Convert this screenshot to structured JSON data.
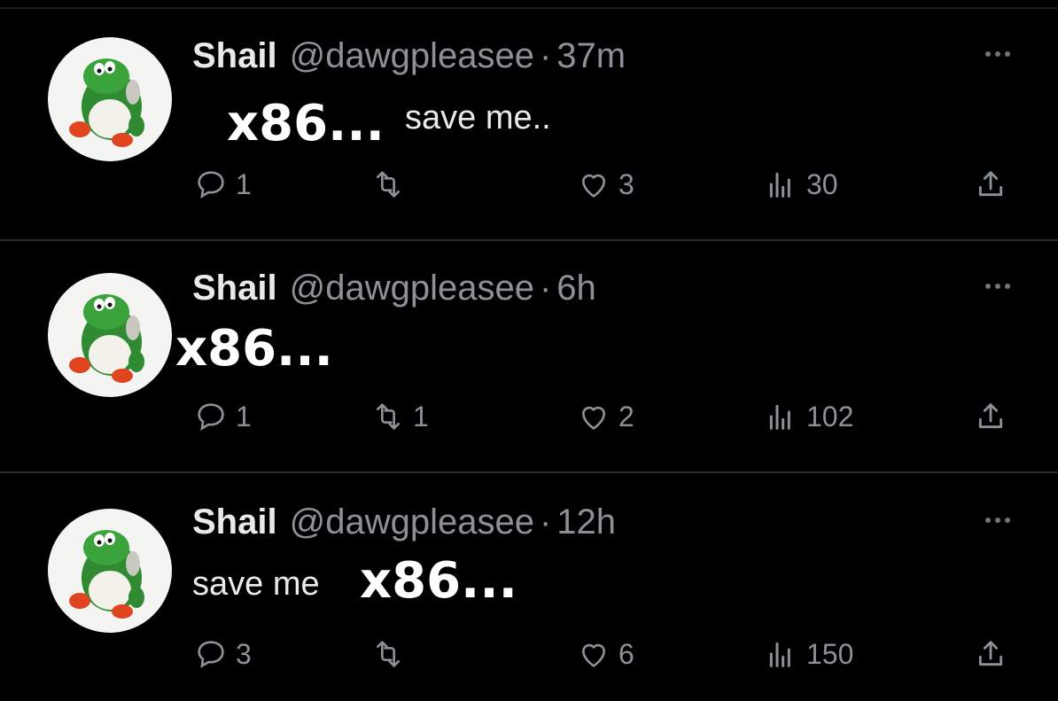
{
  "tweets": [
    {
      "name": "Shail",
      "handle": "@dawgpleasee",
      "separator": "·",
      "time": "37m",
      "overlay": "x86...",
      "text": "save me..",
      "replies": "1",
      "retweets": "",
      "likes": "3",
      "views": "30"
    },
    {
      "name": "Shail",
      "handle": "@dawgpleasee",
      "separator": "·",
      "time": "6h",
      "overlay": "x86...",
      "text": "",
      "replies": "1",
      "retweets": "1",
      "likes": "2",
      "views": "102"
    },
    {
      "name": "Shail",
      "handle": "@dawgpleasee",
      "separator": "·",
      "time": "12h",
      "overlay": "x86...",
      "text": "save me",
      "replies": "3",
      "retweets": "",
      "likes": "6",
      "views": "150"
    }
  ],
  "icons": {
    "avatar": "yoshi-figure-avatar",
    "reply": "speech-bubble-icon",
    "retweet": "retweet-arrows-icon",
    "like": "heart-outline-icon",
    "views": "bar-chart-icon",
    "share": "share-upload-icon",
    "more": "more-dots-icon"
  },
  "colors": {
    "background": "#000000",
    "name": "#e7e9ea",
    "meta": "#8b9196",
    "overlay_text": "#ffffff",
    "divider": "#2a2a2a"
  }
}
